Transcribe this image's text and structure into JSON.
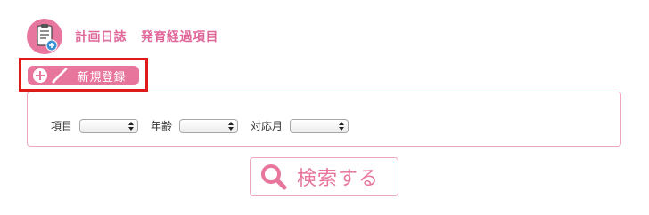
{
  "header": {
    "icon": "clipboard-plus-icon",
    "title": "計画日誌",
    "subtitle": "発育経過項目"
  },
  "actions": {
    "new_label": "新規登録",
    "new_icons": [
      "plus-icon",
      "pencil-icon"
    ]
  },
  "filters": [
    {
      "label": "項目",
      "value": ""
    },
    {
      "label": "年齢",
      "value": ""
    },
    {
      "label": "対応月",
      "value": ""
    }
  ],
  "search": {
    "label": "検索する",
    "icon": "magnifier-icon"
  },
  "colors": {
    "accent": "#e8769c",
    "border": "#f0a6bf",
    "highlight": "#e01a1a"
  }
}
